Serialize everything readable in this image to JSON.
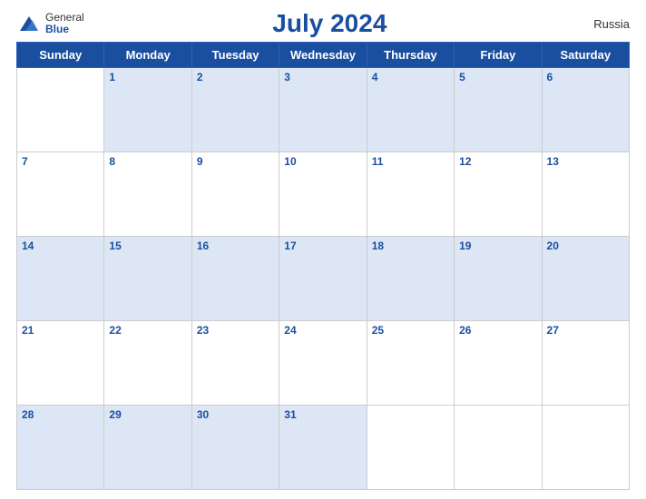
{
  "header": {
    "logo": {
      "general": "General",
      "blue": "Blue"
    },
    "title": "July 2024",
    "country": "Russia"
  },
  "days_of_week": [
    "Sunday",
    "Monday",
    "Tuesday",
    "Wednesday",
    "Thursday",
    "Friday",
    "Saturday"
  ],
  "weeks": [
    [
      {
        "day": "",
        "empty": true
      },
      {
        "day": "1"
      },
      {
        "day": "2"
      },
      {
        "day": "3"
      },
      {
        "day": "4"
      },
      {
        "day": "5"
      },
      {
        "day": "6"
      }
    ],
    [
      {
        "day": "7"
      },
      {
        "day": "8"
      },
      {
        "day": "9"
      },
      {
        "day": "10"
      },
      {
        "day": "11"
      },
      {
        "day": "12"
      },
      {
        "day": "13"
      }
    ],
    [
      {
        "day": "14"
      },
      {
        "day": "15"
      },
      {
        "day": "16"
      },
      {
        "day": "17"
      },
      {
        "day": "18"
      },
      {
        "day": "19"
      },
      {
        "day": "20"
      }
    ],
    [
      {
        "day": "21"
      },
      {
        "day": "22"
      },
      {
        "day": "23"
      },
      {
        "day": "24"
      },
      {
        "day": "25"
      },
      {
        "day": "26"
      },
      {
        "day": "27"
      }
    ],
    [
      {
        "day": "28"
      },
      {
        "day": "29"
      },
      {
        "day": "30"
      },
      {
        "day": "31"
      },
      {
        "day": "",
        "empty": true
      },
      {
        "day": "",
        "empty": true
      },
      {
        "day": "",
        "empty": true
      }
    ]
  ]
}
